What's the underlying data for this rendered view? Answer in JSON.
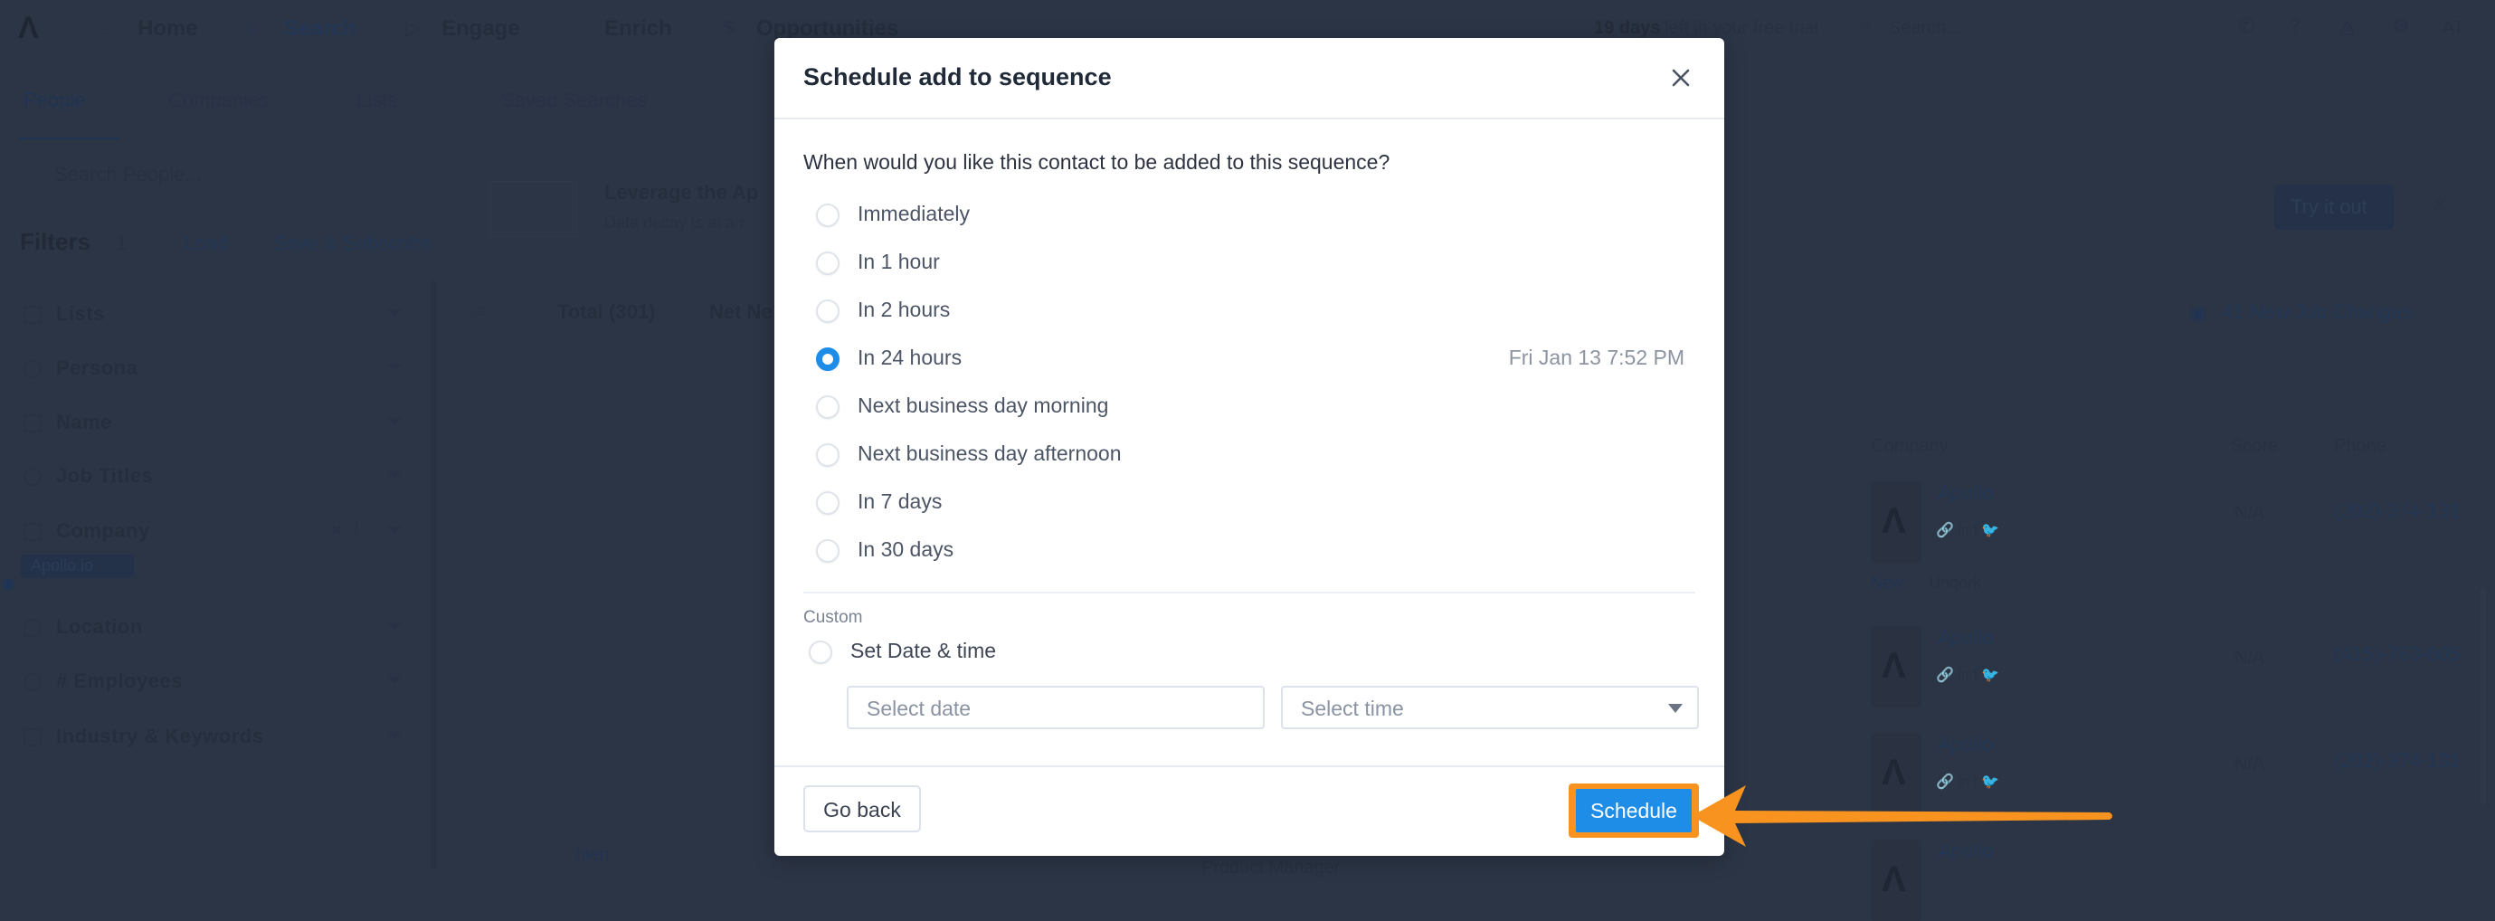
{
  "app": {
    "topnav": {
      "items": [
        {
          "label": "Home",
          "icon": "home-icon"
        },
        {
          "label": "Search",
          "icon": "search-icon"
        },
        {
          "label": "Engage",
          "icon": "send-icon"
        },
        {
          "label": "Enrich",
          "icon": "enrich-icon"
        },
        {
          "label": "Opportunities",
          "icon": "dollar-icon"
        }
      ],
      "trial_days": "19 days",
      "trial_text": "left in your free trial",
      "search_placeholder": "Search...",
      "avatar_initials": "AT"
    },
    "subnav": {
      "tabs": [
        {
          "label": "People",
          "active": true
        },
        {
          "label": "Companies"
        },
        {
          "label": "Lists"
        },
        {
          "label": "Saved Searches"
        }
      ]
    },
    "search_people_placeholder": "Search People...",
    "filters": {
      "title": "Filters",
      "count": "1",
      "load_label": "Load",
      "save_subscribe_label": "Save & Subscribe",
      "items": [
        {
          "label": "Lists"
        },
        {
          "label": "Persona"
        },
        {
          "label": "Name"
        },
        {
          "label": "Job Titles"
        },
        {
          "label": "Company",
          "count": "1",
          "chip": "Apollo.io"
        },
        {
          "label": "Location"
        },
        {
          "label": "# Employees"
        },
        {
          "label": "Industry & Keywords"
        }
      ]
    },
    "banner": {
      "title": "Leverage the Ap",
      "subtitle": "Data decay is at a r",
      "cta": "Try it out"
    },
    "results": {
      "total_tab": "Total (301)",
      "net_new_tab": "Net Ne",
      "job_changes": "41 New Job Changes",
      "columns": [
        "Company",
        "Score",
        "Phone"
      ],
      "rows": [
        {
          "company": "Apollo",
          "score": "N/A",
          "phone": "(202)-374-131"
        },
        {
          "company": "Apollo",
          "score": "N/A",
          "phone": "(415)-763-605",
          "new_company_label": "New:",
          "new_company": "Unqork"
        },
        {
          "company": "Apollo",
          "score": "N/A",
          "phone": "(202)-374-131"
        },
        {
          "company": "Apollo",
          "score": "N/A",
          "phone": "(202)-374-131"
        }
      ],
      "partial_name": "hien",
      "partial_title": "Product Manager"
    }
  },
  "modal": {
    "title": "Schedule add to sequence",
    "question": "When would you like this contact to be added to this sequence?",
    "options": [
      {
        "label": "Immediately",
        "checked": false
      },
      {
        "label": "In 1 hour",
        "checked": false
      },
      {
        "label": "In 2 hours",
        "checked": false
      },
      {
        "label": "In 24 hours",
        "checked": true,
        "meta": "Fri Jan 13 7:52 PM"
      },
      {
        "label": "Next business day morning",
        "checked": false
      },
      {
        "label": "Next business day afternoon",
        "checked": false
      },
      {
        "label": "In 7 days",
        "checked": false
      },
      {
        "label": "In 30 days",
        "checked": false
      }
    ],
    "custom_label": "Custom",
    "custom_option": "Set Date & time",
    "date_placeholder": "Select date",
    "time_placeholder": "Select time",
    "go_back_label": "Go back",
    "schedule_label": "Schedule"
  },
  "colors": {
    "accent": "#1d8de8",
    "annotation": "#f7931e",
    "overlay": "#2c3546"
  }
}
